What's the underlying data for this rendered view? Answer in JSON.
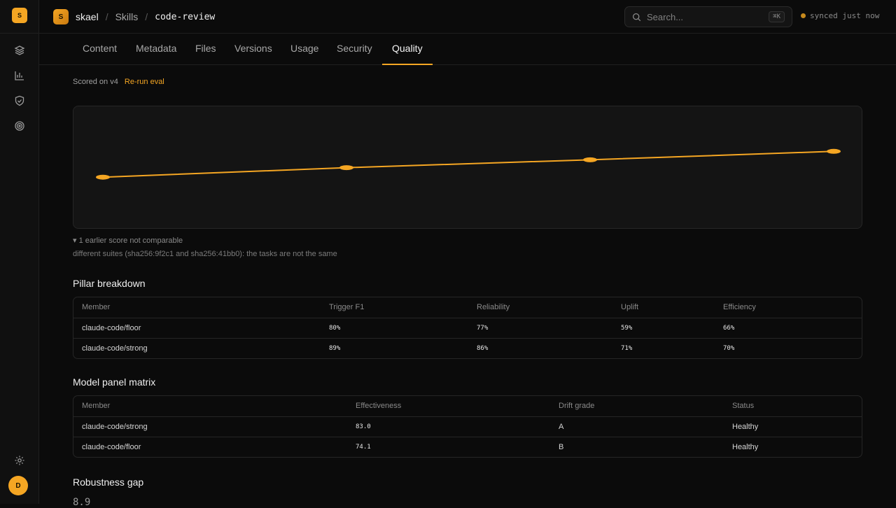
{
  "rail": {
    "logo": "S",
    "avatar": "D"
  },
  "breadcrumb": {
    "badge": "S",
    "org": "skael",
    "section": "Skills",
    "current": "code-review"
  },
  "search": {
    "placeholder": "Search...",
    "shortcut": "⌘K"
  },
  "sync_status": "synced just now",
  "tabs": [
    {
      "label": "Content"
    },
    {
      "label": "Metadata"
    },
    {
      "label": "Files"
    },
    {
      "label": "Versions"
    },
    {
      "label": "Usage"
    },
    {
      "label": "Security"
    },
    {
      "label": "Quality"
    }
  ],
  "active_tab": "Quality",
  "scored": {
    "text": "Scored on v4",
    "action": "Re-run eval"
  },
  "chart_data": {
    "type": "line",
    "x": [
      1,
      2,
      3,
      4
    ],
    "series": [
      {
        "values": [
          74.1,
          77.6,
          80.5,
          83.6
        ]
      }
    ],
    "ylim": [
      60,
      95
    ],
    "grid": false,
    "legend": "none",
    "line_color": "#f5a623"
  },
  "comparability": {
    "summary": "▾ 1 earlier score not comparable",
    "detail": "different suites (sha256:9f2c1 and sha256:41bb0): the tasks are not the same"
  },
  "pillar": {
    "title": "Pillar breakdown",
    "columns": [
      "Member",
      "Trigger F1",
      "Reliability",
      "Uplift",
      "Efficiency"
    ],
    "rows": [
      [
        "claude-code/floor",
        "80%",
        "77%",
        "59%",
        "66%"
      ],
      [
        "claude-code/strong",
        "89%",
        "86%",
        "71%",
        "70%"
      ]
    ]
  },
  "matrix": {
    "title": "Model panel matrix",
    "columns": [
      "Member",
      "Effectiveness",
      "Drift grade",
      "Status"
    ],
    "rows": [
      [
        "claude-code/strong",
        "83.0",
        "A",
        "Healthy"
      ],
      [
        "claude-code/floor",
        "74.1",
        "B",
        "Healthy"
      ]
    ]
  },
  "robustness": {
    "title": "Robustness gap",
    "value": "8.9"
  },
  "colors": {
    "accent": "#f5a623",
    "background": "#0b0b0b",
    "panel": "#141414",
    "border": "#262626"
  }
}
